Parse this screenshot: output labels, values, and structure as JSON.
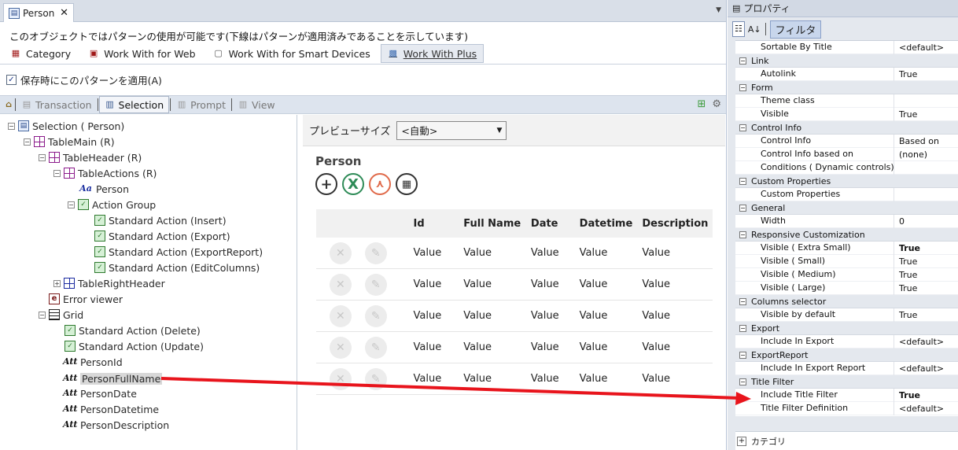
{
  "doc_tab": {
    "label": "Person",
    "close": "✕"
  },
  "notice": "このオブジェクトではパターンの使用が可能です(下線はパターンが適用済みであることを示しています)",
  "pattern_tabs": [
    "Category",
    "Work With for Web",
    "Work With for Smart Devices",
    "Work With Plus"
  ],
  "apply_checkbox": {
    "label": "保存時にこのパターンを適用(A)",
    "checked": true
  },
  "sub_tabs": [
    "Transaction",
    "Selection",
    "Prompt",
    "View"
  ],
  "tree": {
    "root": "Selection ( Person)",
    "table_main": "TableMain (R)",
    "table_header": "TableHeader (R)",
    "table_actions": "TableActions (R)",
    "person_text": "Person",
    "action_group": "Action Group",
    "actions": [
      "Standard Action (Insert)",
      "Standard Action (Export)",
      "Standard Action (ExportReport)",
      "Standard Action (EditColumns)"
    ],
    "table_right_header": "TableRightHeader",
    "error_viewer": "Error viewer",
    "grid": "Grid",
    "grid_actions": [
      "Standard Action (Delete)",
      "Standard Action (Update)"
    ],
    "attributes": [
      "PersonId",
      "PersonFullName",
      "PersonDate",
      "PersonDatetime",
      "PersonDescription"
    ]
  },
  "preview": {
    "size_label": "プレビューサイズ",
    "size_value": "<自動>",
    "title": "Person",
    "columns": [
      "Id",
      "Full Name",
      "Date",
      "Datetime",
      "Description"
    ],
    "rows": [
      [
        "Value",
        "Value",
        "Value",
        "Value",
        "Value"
      ],
      [
        "Value",
        "Value",
        "Value",
        "Value",
        "Value"
      ],
      [
        "Value",
        "Value",
        "Value",
        "Value",
        "Value"
      ],
      [
        "Value",
        "Value",
        "Value",
        "Value",
        "Value"
      ],
      [
        "Value",
        "Value",
        "Value",
        "Value",
        "Value"
      ]
    ]
  },
  "properties": {
    "title": "プロパティ",
    "filter_label": "フィルタ",
    "top_row": {
      "name": "Sortable By Title",
      "value": "<default>"
    },
    "categories": [
      {
        "name": "Link",
        "props": [
          {
            "name": "Autolink",
            "value": "True",
            "bold": false
          }
        ]
      },
      {
        "name": "Form",
        "props": [
          {
            "name": "Theme class",
            "value": "",
            "bold": false
          },
          {
            "name": "Visible",
            "value": "True",
            "bold": false
          }
        ]
      },
      {
        "name": "Control Info",
        "props": [
          {
            "name": "Control Info",
            "value": "Based on",
            "bold": false
          },
          {
            "name": "Control Info based on",
            "value": "(none)",
            "bold": false
          },
          {
            "name": "Conditions ( Dynamic controls)",
            "value": "",
            "bold": false
          }
        ]
      },
      {
        "name": "Custom Properties",
        "props": [
          {
            "name": "Custom Properties",
            "value": "",
            "bold": false
          }
        ]
      },
      {
        "name": "General",
        "props": [
          {
            "name": "Width",
            "value": "0",
            "bold": false
          }
        ]
      },
      {
        "name": "Responsive Customization",
        "props": [
          {
            "name": "Visible ( Extra Small)",
            "value": "True",
            "bold": true
          },
          {
            "name": "Visible ( Small)",
            "value": "True",
            "bold": false
          },
          {
            "name": "Visible ( Medium)",
            "value": "True",
            "bold": false
          },
          {
            "name": "Visible ( Large)",
            "value": "True",
            "bold": false
          }
        ]
      },
      {
        "name": "Columns selector",
        "props": [
          {
            "name": "Visible by default",
            "value": "True",
            "bold": false
          }
        ]
      },
      {
        "name": "Export",
        "props": [
          {
            "name": "Include In Export",
            "value": "<default>",
            "bold": false
          }
        ]
      },
      {
        "name": "ExportReport",
        "props": [
          {
            "name": "Include In Export Report",
            "value": "<default>",
            "bold": false
          }
        ]
      },
      {
        "name": "Title Filter",
        "props": [
          {
            "name": "Include Title Filter",
            "value": "True",
            "bold": true
          },
          {
            "name": "Title Filter Definition",
            "value": "<default>",
            "bold": false
          }
        ]
      }
    ],
    "bottom_category": "カテゴリ"
  },
  "colors": {
    "arrow": "#e8141c",
    "accent": "#1b2fa0"
  }
}
